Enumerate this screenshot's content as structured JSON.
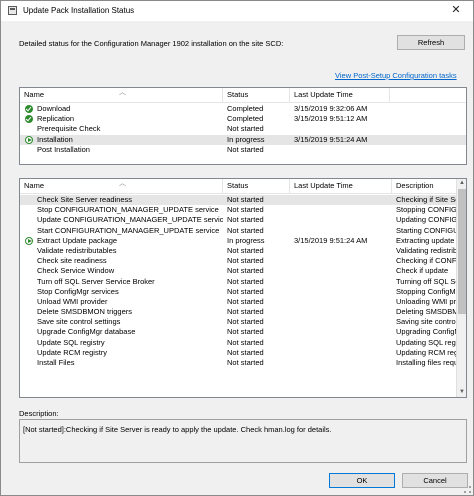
{
  "window": {
    "title": "Update Pack Installation Status",
    "close_glyph": "✕"
  },
  "status_text": "Detailed status for the Configuration Manager 1902 installation on the site SCD:",
  "refresh_label": "Refresh",
  "link_label": "View Post-Setup Configuration tasks",
  "phases": {
    "columns": [
      "Name",
      "Status",
      "Last Update Time"
    ],
    "rows": [
      {
        "icon": "check",
        "name": "Download",
        "status": "Completed",
        "time": "3/15/2019 9:32:06 AM",
        "selected": false
      },
      {
        "icon": "check",
        "name": "Replication",
        "status": "Completed",
        "time": "3/15/2019 9:51:12 AM",
        "selected": false
      },
      {
        "icon": "",
        "name": "Prerequisite Check",
        "status": "Not started",
        "time": "",
        "selected": false
      },
      {
        "icon": "running",
        "name": "Installation",
        "status": "In progress",
        "time": "3/15/2019 9:51:24 AM",
        "selected": true
      },
      {
        "icon": "",
        "name": "Post Installation",
        "status": "Not started",
        "time": "",
        "selected": false
      }
    ]
  },
  "steps": {
    "columns": [
      "Name",
      "Status",
      "Last Update Time",
      "Description"
    ],
    "rows": [
      {
        "icon": "",
        "name": "Check Site Server readiness",
        "status": "Not started",
        "time": "",
        "desc": "Checking if Site Se",
        "selected": true
      },
      {
        "icon": "",
        "name": "Stop CONFIGURATION_MANAGER_UPDATE service",
        "status": "Not started",
        "time": "",
        "desc": "Stopping CONFIG",
        "selected": false
      },
      {
        "icon": "",
        "name": "Update CONFIGURATION_MANAGER_UPDATE service",
        "status": "Not started",
        "time": "",
        "desc": "Updating CONFIGU",
        "selected": false
      },
      {
        "icon": "",
        "name": "Start CONFIGURATION_MANAGER_UPDATE service",
        "status": "Not started",
        "time": "",
        "desc": "Starting CONFIGU",
        "selected": false
      },
      {
        "icon": "running",
        "name": "Extract Update package",
        "status": "In progress",
        "time": "3/15/2019 9:51:24 AM",
        "desc": "Extracting update p",
        "selected": false
      },
      {
        "icon": "",
        "name": "Validate redistributables",
        "status": "Not started",
        "time": "",
        "desc": "Validating redistribu",
        "selected": false
      },
      {
        "icon": "",
        "name": "Check site readiness",
        "status": "Not started",
        "time": "",
        "desc": "Checking if CONFIC",
        "selected": false
      },
      {
        "icon": "",
        "name": "Check Service Window",
        "status": "Not started",
        "time": "",
        "desc": "Check if update",
        "selected": false
      },
      {
        "icon": "",
        "name": "Turn off SQL Server Service Broker",
        "status": "Not started",
        "time": "",
        "desc": "Turning off SQL Se",
        "selected": false
      },
      {
        "icon": "",
        "name": "Stop ConfigMgr services",
        "status": "Not started",
        "time": "",
        "desc": "Stopping ConfigMg",
        "selected": false
      },
      {
        "icon": "",
        "name": "Unload WMI provider",
        "status": "Not started",
        "time": "",
        "desc": "Unloading WMI pro",
        "selected": false
      },
      {
        "icon": "",
        "name": "Delete SMSDBMON triggers",
        "status": "Not started",
        "time": "",
        "desc": "Deleting SMSDBMO",
        "selected": false
      },
      {
        "icon": "",
        "name": "Save site control settings",
        "status": "Not started",
        "time": "",
        "desc": "Saving site control",
        "selected": false
      },
      {
        "icon": "",
        "name": "Upgrade ConfigMgr database",
        "status": "Not started",
        "time": "",
        "desc": "Upgrading ConfigM",
        "selected": false
      },
      {
        "icon": "",
        "name": "Update SQL registry",
        "status": "Not started",
        "time": "",
        "desc": "Updating SQL regis",
        "selected": false
      },
      {
        "icon": "",
        "name": "Update RCM registry",
        "status": "Not started",
        "time": "",
        "desc": "Updating RCM regis",
        "selected": false
      },
      {
        "icon": "",
        "name": "Install Files",
        "status": "Not started",
        "time": "",
        "desc": "Installing files requ",
        "selected": false
      }
    ]
  },
  "description_label": "Description:",
  "description_text": "[Not started]:Checking if Site Server is ready to apply the update. Check hman.log for details.",
  "ok_label": "OK",
  "cancel_label": "Cancel"
}
